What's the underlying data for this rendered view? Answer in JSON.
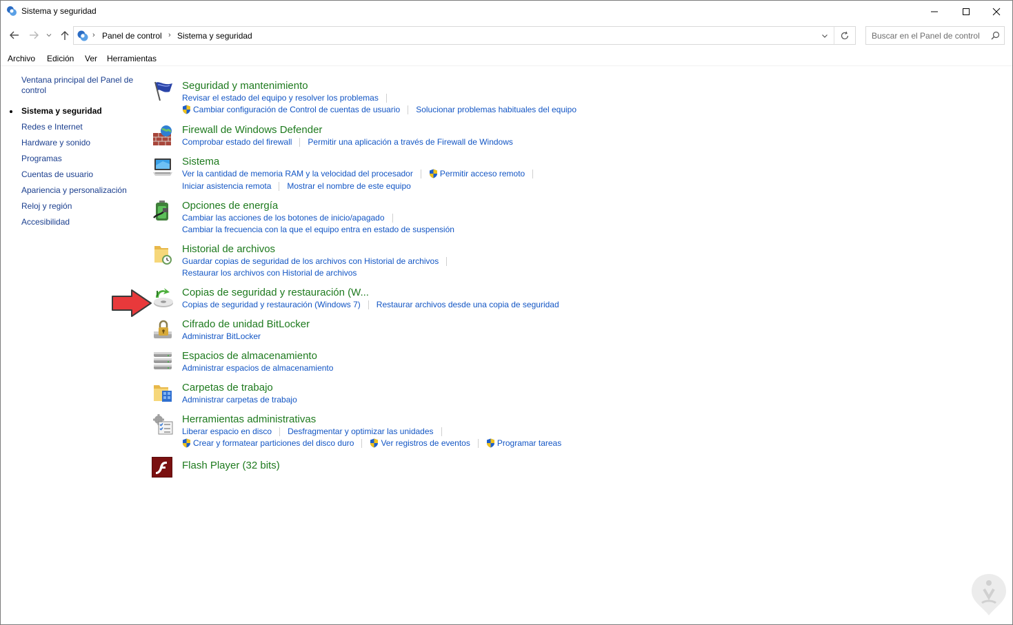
{
  "window": {
    "title": "Sistema y seguridad"
  },
  "address": {
    "crumbs": [
      "Panel de control",
      "Sistema y seguridad"
    ]
  },
  "search": {
    "placeholder": "Buscar en el Panel de control"
  },
  "menu": [
    "Archivo",
    "Edición",
    "Ver",
    "Herramientas"
  ],
  "sidebar": {
    "items": [
      {
        "label": "Ventana principal del Panel de control",
        "label_line1": "Ventana principal del Panel de",
        "label_line2": "control"
      },
      {
        "label": "Sistema y seguridad",
        "current": true
      },
      {
        "label": "Redes e Internet"
      },
      {
        "label": "Hardware y sonido"
      },
      {
        "label": "Programas"
      },
      {
        "label": "Cuentas de usuario"
      },
      {
        "label": "Apariencia y personalización"
      },
      {
        "label": "Reloj y región"
      },
      {
        "label": "Accesibilidad"
      }
    ]
  },
  "categories": [
    {
      "title": "Seguridad y mantenimiento",
      "icon": "flag-icon",
      "lines": [
        [
          {
            "label": "Revisar el estado del equipo y resolver los problemas"
          }
        ],
        [
          {
            "label": "Cambiar configuración de Control de cuentas de usuario",
            "shield": true
          },
          {
            "label": "Solucionar problemas habituales del equipo"
          }
        ]
      ]
    },
    {
      "title": "Firewall de Windows Defender",
      "icon": "firewall-icon",
      "lines": [
        [
          {
            "label": "Comprobar estado del firewall"
          },
          {
            "label": "Permitir una aplicación a través de Firewall de Windows"
          }
        ]
      ]
    },
    {
      "title": "Sistema",
      "icon": "computer-icon",
      "lines": [
        [
          {
            "label": "Ver la cantidad de memoria RAM y la velocidad del procesador"
          },
          {
            "label": "Permitir acceso remoto",
            "shield": true
          }
        ],
        [
          {
            "label": "Iniciar asistencia remota"
          },
          {
            "label": "Mostrar el nombre de este equipo"
          }
        ]
      ]
    },
    {
      "title": "Opciones de energía",
      "icon": "battery-icon",
      "lines": [
        [
          {
            "label": "Cambiar las acciones de los botones de inicio/apagado"
          }
        ],
        [
          {
            "label": "Cambiar la frecuencia con la que el equipo entra en estado de suspensión"
          }
        ]
      ]
    },
    {
      "title": "Historial de archivos",
      "icon": "file-history-icon",
      "lines": [
        [
          {
            "label": "Guardar copias de seguridad de los archivos con Historial de archivos"
          }
        ],
        [
          {
            "label": "Restaurar los archivos con Historial de archivos"
          }
        ]
      ]
    },
    {
      "title": "Copias de seguridad y restauración (W...",
      "icon": "backup-icon",
      "lines": [
        [
          {
            "label": "Copias de seguridad y restauración (Windows 7)"
          },
          {
            "label": "Restaurar archivos desde una copia de seguridad"
          }
        ]
      ]
    },
    {
      "title": "Cifrado de unidad BitLocker",
      "icon": "bitlocker-icon",
      "lines": [
        [
          {
            "label": "Administrar BitLocker"
          }
        ]
      ]
    },
    {
      "title": "Espacios de almacenamiento",
      "icon": "storage-spaces-icon",
      "lines": [
        [
          {
            "label": "Administrar espacios de almacenamiento"
          }
        ]
      ]
    },
    {
      "title": "Carpetas de trabajo",
      "icon": "work-folders-icon",
      "lines": [
        [
          {
            "label": "Administrar carpetas de trabajo"
          }
        ]
      ]
    },
    {
      "title": "Herramientas administrativas",
      "icon": "admin-tools-icon",
      "lines": [
        [
          {
            "label": "Liberar espacio en disco"
          },
          {
            "label": "Desfragmentar y optimizar las unidades"
          }
        ],
        [
          {
            "label": "Crear y formatear particiones del disco duro",
            "shield": true
          },
          {
            "label": "Ver registros de eventos",
            "shield": true
          },
          {
            "label": "Programar tareas",
            "shield": true
          }
        ]
      ]
    },
    {
      "title": "Flash Player (32 bits)",
      "icon": "flash-icon",
      "lines": []
    }
  ],
  "colors": {
    "category_title": "#1e7a1e",
    "task_link": "#1255c4",
    "nav_link": "#1a3e8e",
    "arrow": "#e8393b"
  }
}
